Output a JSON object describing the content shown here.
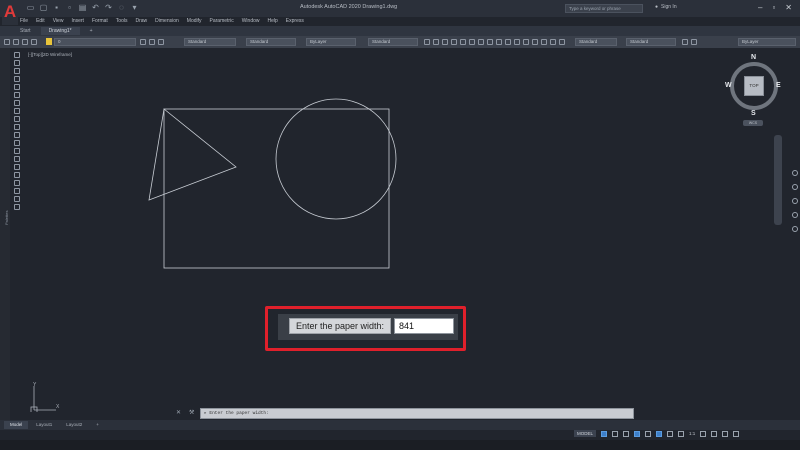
{
  "app": {
    "logo_letter": "A",
    "title": "Autodesk AutoCAD 2020   Drawing1.dwg",
    "search_placeholder": "Type a keyword or phrase",
    "signin": "Sign In"
  },
  "menu": [
    "File",
    "Edit",
    "View",
    "Insert",
    "Format",
    "Tools",
    "Draw",
    "Dimension",
    "Modify",
    "Parametric",
    "Window",
    "Help",
    "Express"
  ],
  "file_tabs": [
    {
      "label": "Start",
      "active": false
    },
    {
      "label": "Drawing1*",
      "active": true
    }
  ],
  "toolbar": {
    "layer_value": "0",
    "text_style": "Standard",
    "dim_style": "Standard",
    "color": "ByLayer",
    "linetype": "Standard",
    "plot_style": "Standard",
    "table_style": "Standard",
    "lineweight": "ByLayer"
  },
  "viewport_label": "[-][Top][2D Wireframe]",
  "left_panel_label": "Palettes",
  "viewcube": {
    "north": "N",
    "south": "S",
    "east": "E",
    "west": "W",
    "face": "TOP",
    "wcs": "WCS"
  },
  "ucs": {
    "x_label": "X",
    "y_label": "Y"
  },
  "dynamic_prompt": {
    "label": "Enter the paper width:",
    "value": "841"
  },
  "command_line": {
    "text": "▸ Enter the paper width:"
  },
  "layout_tabs": [
    {
      "label": "Model",
      "active": true
    },
    {
      "label": "Layout1",
      "active": false
    },
    {
      "label": "Layout2",
      "active": false
    }
  ],
  "status": {
    "model": "MODEL",
    "scale": "1:1"
  },
  "colors": {
    "canvas": "#21252d",
    "highlight": "#e0202b",
    "drawing_line": "#c8cdd4"
  }
}
